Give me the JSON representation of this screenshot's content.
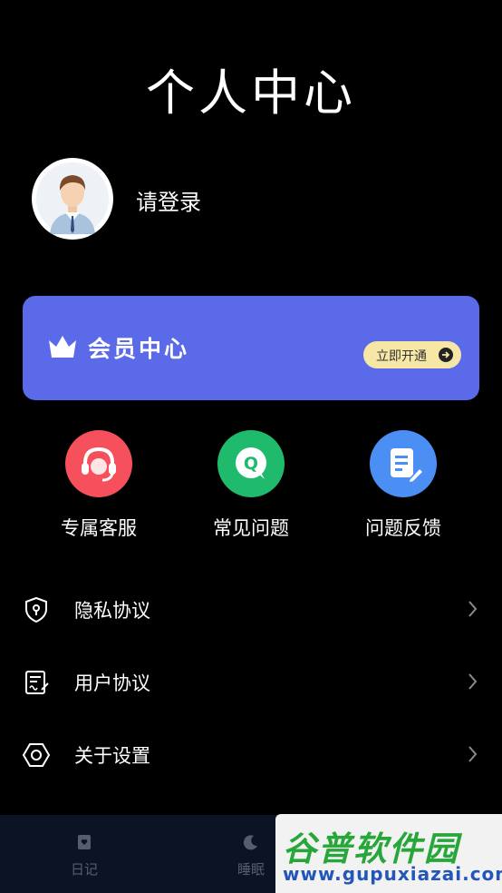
{
  "header": {
    "title": "个人中心"
  },
  "profile": {
    "login_text": "请登录"
  },
  "vip": {
    "title": "会员中心",
    "button_label": "立即开通"
  },
  "services": [
    {
      "label": "专属客服",
      "icon": "headset-icon",
      "color": "#f5505c"
    },
    {
      "label": "常见问题",
      "icon": "faq-icon",
      "color": "#1fba6c"
    },
    {
      "label": "问题反馈",
      "icon": "feedback-icon",
      "color": "#4b8ff5"
    }
  ],
  "menu": [
    {
      "label": "隐私协议",
      "icon": "shield-icon"
    },
    {
      "label": "用户协议",
      "icon": "document-icon"
    },
    {
      "label": "关于设置",
      "icon": "hexagon-settings-icon"
    }
  ],
  "tabbar": {
    "items": [
      {
        "label": "日记",
        "icon": "diary-icon"
      },
      {
        "label": "睡眠",
        "icon": "moon-icon"
      }
    ]
  },
  "watermark": {
    "title": "谷普软件园",
    "url": "www.gupuxiazai.com"
  }
}
